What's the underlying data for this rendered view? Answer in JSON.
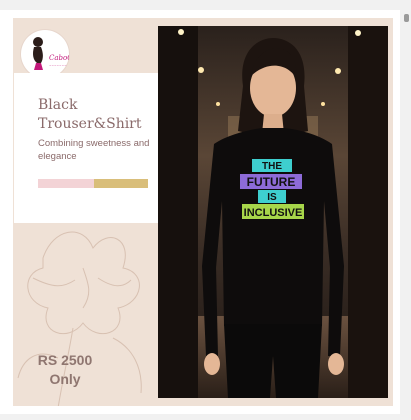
{
  "brand": {
    "logo_text": "CaboCasa"
  },
  "product": {
    "title": "Black Trouser&Shirt",
    "tagline": "Combining sweetness and elegance",
    "price_line1": "RS 2500",
    "price_line2": "Only"
  },
  "shirt_print": [
    "THE",
    "FUTURE",
    "IS",
    "INCLUSIVE"
  ],
  "colors": {
    "background": "#efe1d6",
    "accent_pink": "#f3d3d6",
    "accent_gold": "#d9be7a",
    "text": "#8a6a6a"
  }
}
